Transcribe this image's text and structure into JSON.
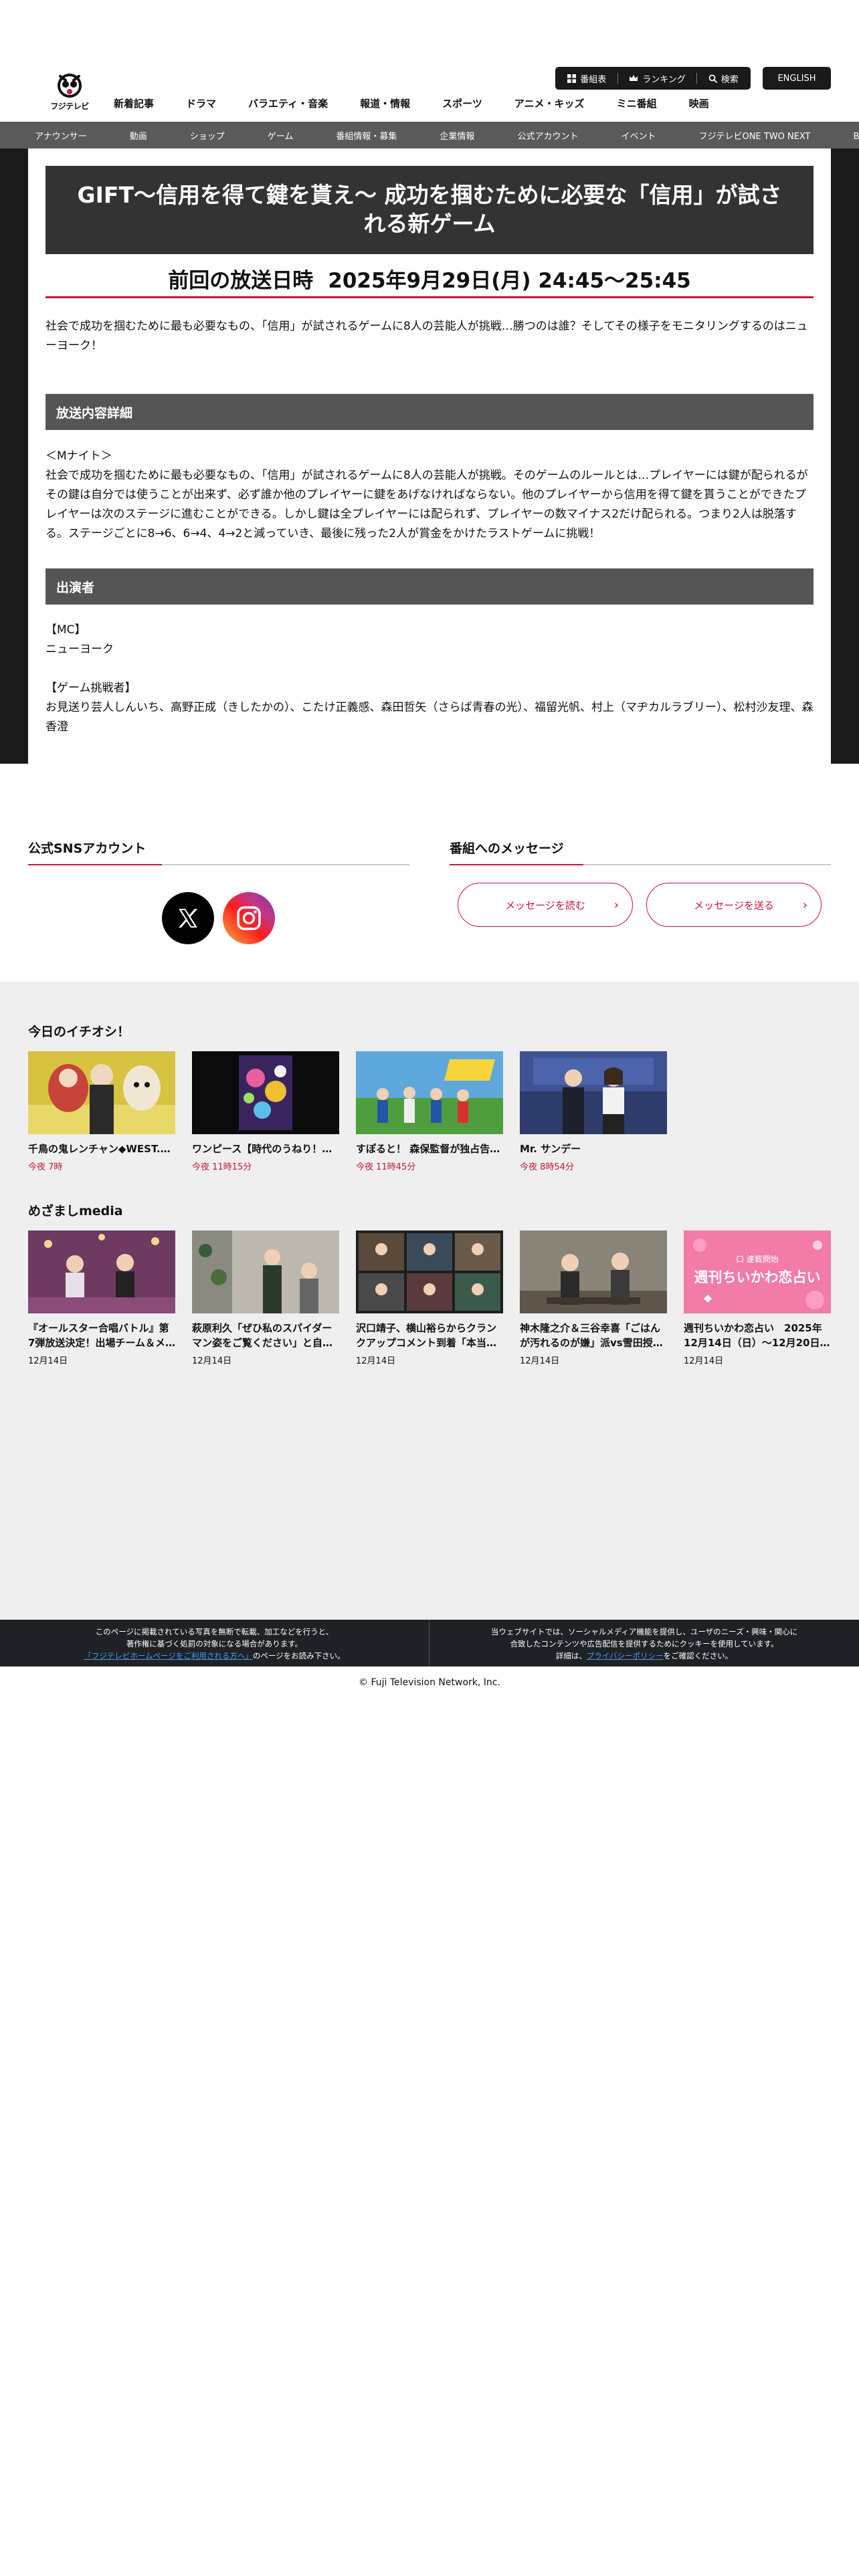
{
  "header": {
    "logo_text": "フジテレビ",
    "util": {
      "guide": "番組表",
      "ranking": "ランキング",
      "search": "検索"
    },
    "lang": "ENGLISH",
    "main_nav": [
      "新着記事",
      "ドラマ",
      "バラエティ・音楽",
      "報道・情報",
      "スポーツ",
      "アニメ・キッズ",
      "ミニ番組",
      "映画"
    ],
    "sub_nav": [
      "アナウンサー",
      "動画",
      "ショップ",
      "ゲーム",
      "番組情報・募集",
      "企業情報",
      "公式アカウント",
      "イベント",
      "フジテレビONE TWO NEXT",
      "BSフジ"
    ]
  },
  "program": {
    "title": "GIFT〜信用を得て鍵を貰え〜 成功を掴むために必要な「信用」が試される新ゲーム",
    "broadcast_label": "前回の放送日時",
    "broadcast_datetime": "2025年9月29日(月) 24:45〜25:45",
    "intro": "社会で成功を掴むために最も必要なもの、「信用」が試されるゲームに8人の芸能人が挑戦…勝つのは誰？そしてその様子をモニタリングするのはニューヨーク！",
    "detail_heading": "放送内容詳細",
    "detail_sub": "＜Mナイト＞",
    "detail_body": "社会で成功を掴むために最も必要なもの、「信用」が試されるゲームに8人の芸能人が挑戦。そのゲームのルールとは…プレイヤーには鍵が配られるがその鍵は自分では使うことが出来ず、必ず誰か他のプレイヤーに鍵をあげなければならない。他のプレイヤーから信用を得て鍵を貰うことができたプレイヤーは次のステージに進むことができる。しかし鍵は全プレイヤーには配られず、プレイヤーの数マイナス2だけ配られる。つまり2人は脱落する。ステージごとに8→6、6→4、4→2と減っていき、最後に残った2人が賞金をかけたラストゲームに挑戦！",
    "cast_heading": "出演者",
    "mc_label": "【MC】",
    "mc_names": "ニューヨーク",
    "challenger_label": "【ゲーム挑戦者】",
    "challenger_names": "お見送り芸人しんいち、高野正成（きしたかの）、こたけ正義感、森田哲矢（さらば青春の光）、福留光帆、村上（マヂカルラブリー）、松村沙友理、森香澄"
  },
  "sns": {
    "heading": "公式SNSアカウント"
  },
  "messages": {
    "heading": "番組へのメッセージ",
    "read": "メッセージを読む",
    "send": "メッセージを送る"
  },
  "ichioshi": {
    "heading": "今日のイチオシ！",
    "items": [
      {
        "caption": "千鳥の鬼レンチャン◆WEST.…",
        "time": "今夜 7時"
      },
      {
        "caption": "ワンピース【時代のうねり！…",
        "time": "今夜 11時15分"
      },
      {
        "caption": "すぽると！ 森保監督が独占告…",
        "time": "今夜 11時45分"
      },
      {
        "caption": "Mr. サンデー",
        "time": "今夜 8時54分"
      }
    ]
  },
  "mezamashi": {
    "heading": "めざましmedia",
    "items": [
      {
        "caption": "『オールスター合唱バトル』第7弾放送決定！出場チーム＆メ…",
        "date": "12月14日"
      },
      {
        "caption": "萩原利久「ぜひ私のスパイダーマン姿をご覧ください」と自…",
        "date": "12月14日"
      },
      {
        "caption": "沢口靖子、横山裕らからクランクアップコメント到着「本当…",
        "date": "12月14日"
      },
      {
        "caption": "神木隆之介＆三谷幸喜「ごはんが汚れるのが嫌」派vs雪田授…",
        "date": "12月14日"
      },
      {
        "caption": "週刊ちいかわ恋占い　2025年12月14日（日）〜12月20日…",
        "date": "12月14日"
      }
    ],
    "banner_text": "週刊ちいかわ恋占い",
    "banner_sub": "口 連載開始"
  },
  "footer": {
    "left_line1": "このページに掲載されている写真を無断で転載、加工などを行うと、",
    "left_line2": "著作権に基づく処罰の対象になる場合があります。",
    "left_link": "「フジテレビホームページをご利用される方へ」",
    "left_tail": "のページをお読み下さい。",
    "right_line1": "当ウェブサイトでは、ソーシャルメディア機能を提供し、ユーザのニーズ・興味・関心に",
    "right_line2": "合致したコンテンツや広告配信を提供するためにクッキーを使用しています。",
    "right_pre": "詳細は、",
    "right_link": "プライバシーポリシー",
    "right_tail": "をご確認ください。",
    "copyright": "© Fuji Television Network, Inc."
  },
  "colors": {
    "accent": "#c4163a",
    "dark": "#1a1a1a",
    "section_bar": "#555555",
    "gray_bg": "#efefef"
  }
}
